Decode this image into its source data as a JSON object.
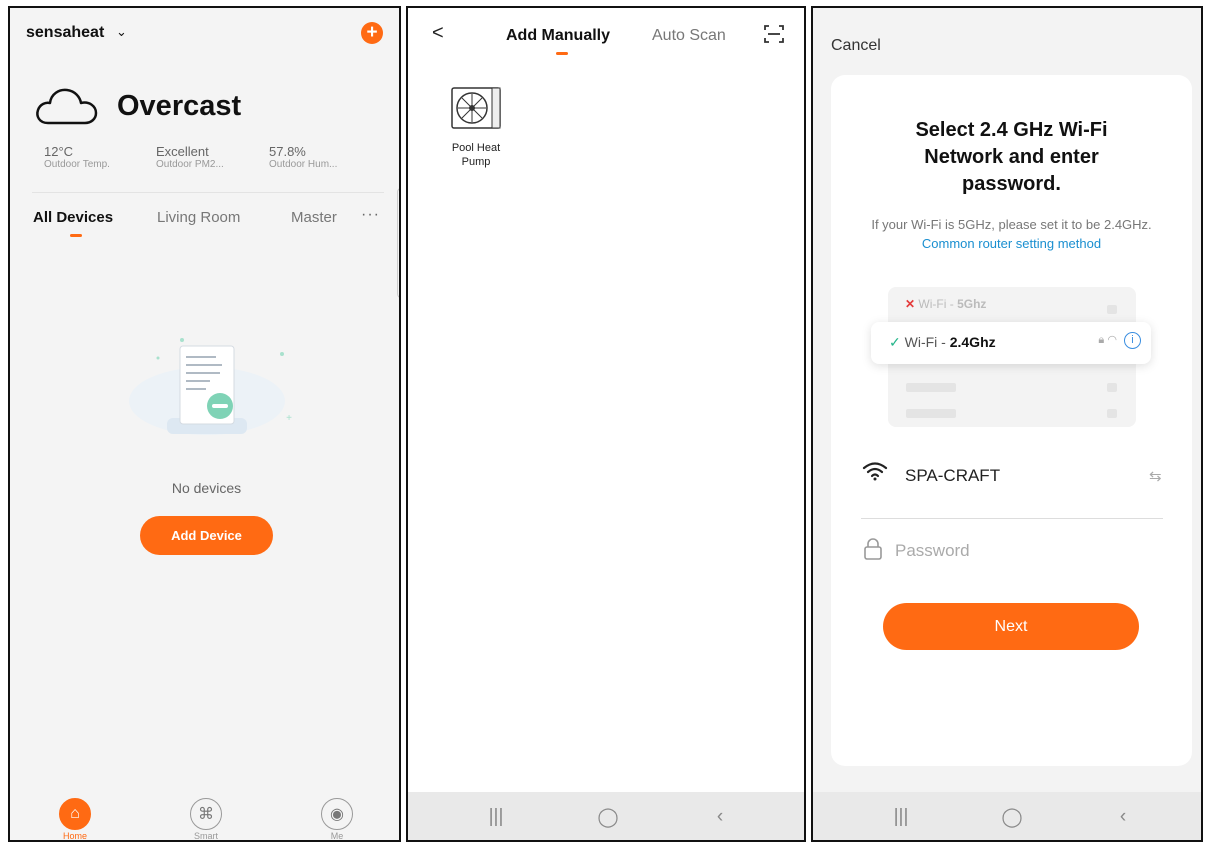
{
  "home": {
    "name": "sensaheat",
    "weather": "Overcast",
    "stats": [
      {
        "value": "12°C",
        "label": "Outdoor Temp."
      },
      {
        "value": "Excellent",
        "label": "Outdoor PM2..."
      },
      {
        "value": "57.8%",
        "label": "Outdoor Hum..."
      }
    ],
    "rooms": [
      "All Devices",
      "Living Room",
      "Master"
    ],
    "more": "···",
    "empty_text": "No devices",
    "add_button": "Add Device",
    "nav": [
      "Home",
      "Smart",
      "Me"
    ]
  },
  "add_device": {
    "tabs": [
      "Add Manually",
      "Auto Scan"
    ],
    "devices": [
      {
        "label_line1": "Pool Heat",
        "label_line2": "Pump"
      }
    ]
  },
  "wifi": {
    "cancel": "Cancel",
    "title_lines": [
      "Select 2.4 GHz Wi-Fi",
      "Network and enter",
      "password."
    ],
    "hint": "If your Wi-Fi is 5GHz, please set it to be 2.4GHz.",
    "link": "Common router setting method",
    "example_5g_prefix": "Wi-Fi - ",
    "example_5g_band": "5Ghz",
    "example_24_prefix": "Wi-Fi - ",
    "example_24_band": "2.4Ghz",
    "ssid": "SPA-CRAFT",
    "password_placeholder": "Password",
    "next": "Next"
  },
  "system_nav": {
    "recents": "|||",
    "home": "◯",
    "back": "‹"
  },
  "colors": {
    "accent": "#ff6a13",
    "link": "#1a8fd0",
    "check": "#24b58a",
    "error": "#e43a3a"
  }
}
